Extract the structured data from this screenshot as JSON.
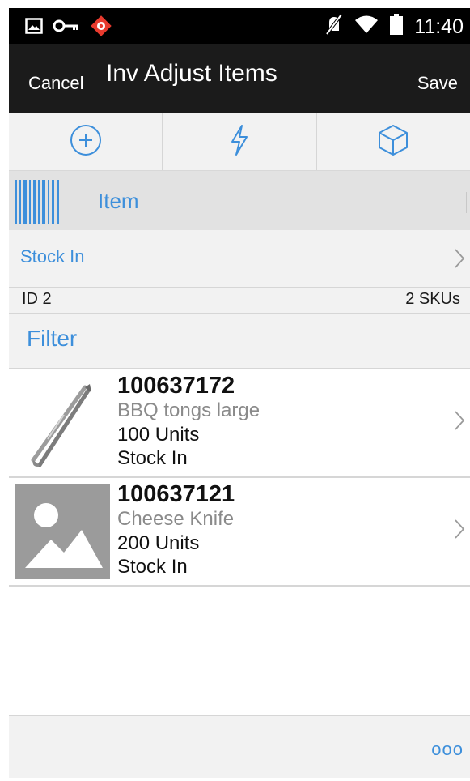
{
  "status_bar": {
    "time": "11:40",
    "icons": [
      "image-icon",
      "key-icon",
      "app-notification-icon",
      "mute-icon",
      "wifi-icon",
      "battery-icon"
    ]
  },
  "header": {
    "cancel_label": "Cancel",
    "title": "Inv Adjust Items",
    "save_label": "Save"
  },
  "toolbar": {
    "actions": [
      "add-icon",
      "flash-icon",
      "box-icon"
    ]
  },
  "scan": {
    "label": "Item"
  },
  "reason": {
    "label": "Stock In"
  },
  "info": {
    "id_text": "ID 2",
    "sku_count": "2 SKUs"
  },
  "filter": {
    "label": "Filter"
  },
  "items": [
    {
      "id": "100637172",
      "description": "BBQ tongs large",
      "quantity": "100 Units",
      "reason": "Stock In",
      "thumbnail": "tongs-image"
    },
    {
      "id": "100637121",
      "description": "Cheese Knife",
      "quantity": "200 Units",
      "reason": "Stock In",
      "thumbnail": "placeholder-image-icon"
    }
  ],
  "footer": {
    "more_label": "ooo"
  },
  "colors": {
    "accent": "#3d8fdb",
    "header_bg": "#1b1b1b",
    "status_bg": "#000000",
    "surface": "#f2f2f2",
    "divider": "#d6d6d6"
  }
}
